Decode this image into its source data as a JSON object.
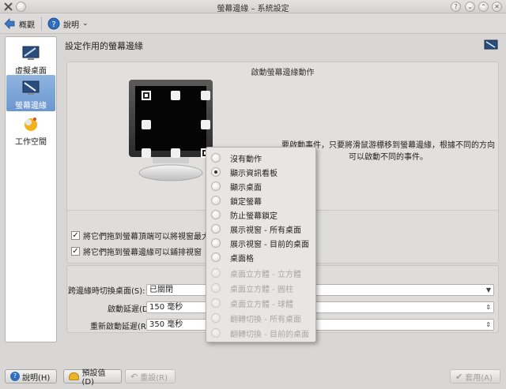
{
  "window": {
    "title": "螢幕邊緣 – 系統設定"
  },
  "toolbar": {
    "overview_label": "概觀",
    "help_label": "說明"
  },
  "sidebar": {
    "items": [
      {
        "label": "虛擬桌面",
        "icon": "virtual-desktop-icon"
      },
      {
        "label": "螢幕邊緣",
        "icon": "screen-edges-icon"
      },
      {
        "label": "工作空間",
        "icon": "workspace-icon"
      }
    ]
  },
  "main": {
    "title": "設定作用的螢幕邊緣",
    "group_title": "啟動螢幕邊緣動作",
    "description": "要啟動事件，只要將滑鼠游標移到螢幕邊緣，根據不同的方向可以啟動不同的事件。",
    "checkbox_max": "將它們拖到螢幕頂端可以將視窗最大化",
    "checkbox_tile": "將它們拖到螢幕邊緣可以鋪排視窗",
    "switch_desktop_label": "跨邊緣時切換桌面(S):",
    "switch_desktop_value": "已關閉",
    "activation_delay_label": "啟動延遲(D):",
    "activation_delay_value": "150 毫秒",
    "reactivation_delay_label": "重新啟動延遲(R):",
    "reactivation_delay_value": "350 毫秒"
  },
  "buttons": {
    "help": "說明(H)",
    "defaults": "預設值(D)",
    "reset": "重設(R)",
    "apply": "套用(A)"
  },
  "menu": {
    "items": [
      {
        "label": "沒有動作",
        "checked": false,
        "enabled": true
      },
      {
        "label": "顯示資訊看板",
        "checked": true,
        "enabled": true
      },
      {
        "label": "顯示桌面",
        "checked": false,
        "enabled": true
      },
      {
        "label": "鎖定螢幕",
        "checked": false,
        "enabled": true
      },
      {
        "label": "防止螢幕鎖定",
        "checked": false,
        "enabled": true
      },
      {
        "label": "展示視窗 - 所有桌面",
        "checked": false,
        "enabled": true
      },
      {
        "label": "展示視窗 - 目前的桌面",
        "checked": false,
        "enabled": true
      },
      {
        "label": "桌面格",
        "checked": false,
        "enabled": true
      },
      {
        "label": "桌面立方體 - 立方體",
        "checked": false,
        "enabled": false
      },
      {
        "label": "桌面立方體 - 圓柱",
        "checked": false,
        "enabled": false
      },
      {
        "label": "桌面立方體 - 球體",
        "checked": false,
        "enabled": false
      },
      {
        "label": "翻轉切換 - 所有桌面",
        "checked": false,
        "enabled": false
      },
      {
        "label": "翻轉切換 - 目前的桌面",
        "checked": false,
        "enabled": false
      }
    ]
  }
}
